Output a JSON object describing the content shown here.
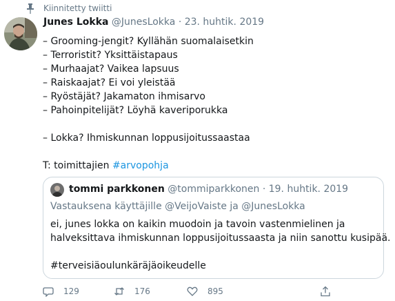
{
  "pinned": {
    "label": "Kiinnitetty twiitti"
  },
  "tweet": {
    "author_name": "Junes Lokka",
    "handle": "@JunesLokka",
    "separator": "·",
    "date": "23. huhtik. 2019",
    "lines": [
      "– Grooming-jengit? Kyllähän suomalaisetkin",
      "– Terroristit? Yksittäistapaus",
      "– Murhaajat? Vaikea lapsuus",
      "– Raiskaajat? Ei voi yleistää",
      "– Ryöstäjät? Jakamaton ihmisarvo",
      "– Pahoinpitelijät? Löyhä kaveriporukka",
      "– Lokka? Ihmiskunnan loppusijoitussaastaa"
    ],
    "signature_prefix": "T: toimittajien ",
    "signature_hashtag": "#arvopohja"
  },
  "quote": {
    "author_name": "tommi parkkonen",
    "handle": "@tommiparkkonen",
    "separator": "·",
    "date": "19. huhtik. 2019",
    "reply_to": "Vastauksena käyttäjille @VeijoVaiste ja @JunesLokka",
    "lines": [
      "ei, junes lokka on kaikin muodoin ja tavoin vastenmielinen ja",
      "halveksittava ihmiskunnan loppusijoitussaasta ja niin sanottu kusipää."
    ],
    "hashtag_line": "#terveisiäoulunkäräjäoikeudelle"
  },
  "actions": {
    "reply_count": "129",
    "retweet_count": "176",
    "like_count": "895"
  },
  "icons": {
    "pinned": "pin-icon",
    "reply": "reply-icon",
    "retweet": "retweet-icon",
    "like": "heart-icon",
    "share": "share-icon"
  },
  "colors": {
    "text": "#14171a",
    "secondary": "#657786",
    "link": "#1b95e0",
    "border": "#ccd6dd"
  }
}
